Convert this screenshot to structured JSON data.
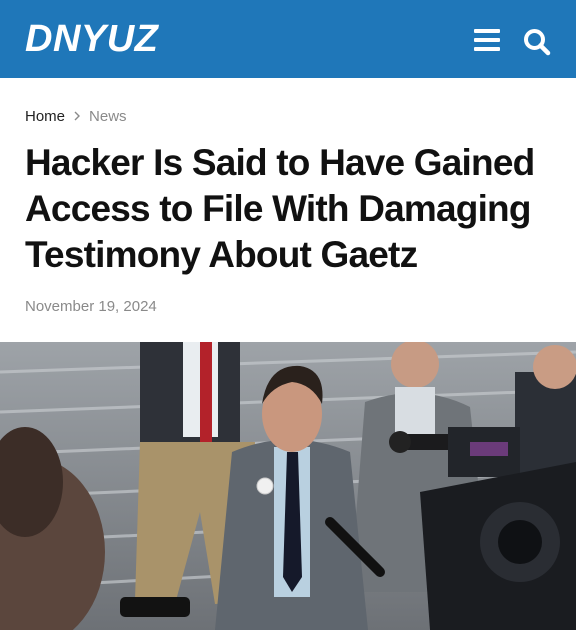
{
  "header": {
    "logo": "DNYUZ",
    "menu_icon": "hamburger-menu-icon",
    "search_icon": "search-icon",
    "bg_color": "#1f77b9"
  },
  "breadcrumb": {
    "home": "Home",
    "separator_icon": "chevron-right-icon",
    "category": "News"
  },
  "article": {
    "headline": "Hacker Is Said to Have Gained Access to File With Damaging Testimony About Gaetz",
    "date": "November 19, 2024"
  }
}
